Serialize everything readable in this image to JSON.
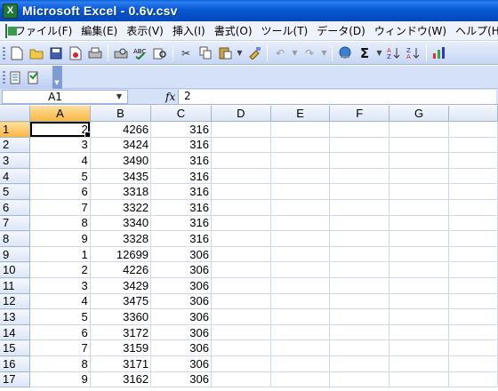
{
  "window": {
    "title": "Microsoft Excel - 0.6v.csv",
    "app_icon_letter": "X"
  },
  "menu": {
    "items": [
      "ファイル(F)",
      "編集(E)",
      "表示(V)",
      "挿入(I)",
      "書式(O)",
      "ツール(T)",
      "データ(D)",
      "ウィンドウ(W)",
      "ヘルプ(H)"
    ]
  },
  "toolbar": {
    "icons": [
      "new-icon",
      "open-icon",
      "save-icon",
      "permission-icon",
      "print-icon",
      "print-preview-icon",
      "spelling-icon",
      "research-icon",
      "cut-icon",
      "copy-icon",
      "paste-icon",
      "format-painter-icon",
      "undo-icon",
      "redo-icon",
      "hyperlink-icon",
      "autosum-icon",
      "sort-ascending-icon",
      "sort-descending-icon",
      "chart-wizard-icon"
    ]
  },
  "formula_bar": {
    "name_box": "A1",
    "fx_label": "fx",
    "content": "2"
  },
  "sheet": {
    "columns": [
      "A",
      "B",
      "C",
      "D",
      "E",
      "F",
      "G"
    ],
    "row_numbers": [
      "1",
      "2",
      "3",
      "4",
      "5",
      "6",
      "7",
      "8",
      "9",
      "10",
      "11",
      "12",
      "13",
      "14",
      "15",
      "16",
      "17"
    ],
    "rows": [
      [
        "2",
        "4266",
        "316"
      ],
      [
        "3",
        "3424",
        "316"
      ],
      [
        "4",
        "3490",
        "316"
      ],
      [
        "5",
        "3435",
        "316"
      ],
      [
        "6",
        "3318",
        "316"
      ],
      [
        "7",
        "3322",
        "316"
      ],
      [
        "8",
        "3340",
        "316"
      ],
      [
        "9",
        "3328",
        "316"
      ],
      [
        "1",
        "12699",
        "306"
      ],
      [
        "2",
        "4226",
        "306"
      ],
      [
        "3",
        "3429",
        "306"
      ],
      [
        "4",
        "3475",
        "306"
      ],
      [
        "5",
        "3360",
        "306"
      ],
      [
        "6",
        "3172",
        "306"
      ],
      [
        "7",
        "3159",
        "306"
      ],
      [
        "8",
        "3171",
        "306"
      ],
      [
        "9",
        "3162",
        "306"
      ]
    ],
    "active_cell": "A1"
  }
}
